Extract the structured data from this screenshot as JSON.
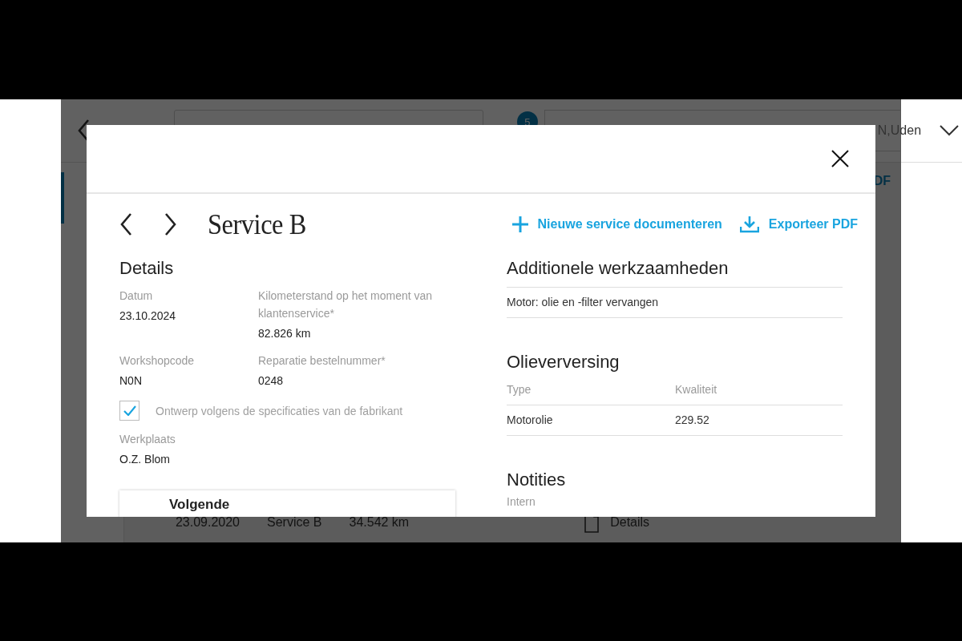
{
  "background": {
    "badge": "5",
    "location": "N,Uden",
    "export_link": "DF",
    "history_row": {
      "date": "23.09.2020",
      "service": "Service B",
      "mileage": "34.542 km",
      "details_link": "Details"
    }
  },
  "modal": {
    "title": "Service B",
    "actions": [
      {
        "kind": "add",
        "label": "Nieuwe service documenteren"
      },
      {
        "kind": "export",
        "label": "Exporteer PDF"
      }
    ],
    "details": {
      "heading": "Details",
      "fields": [
        {
          "label": "Datum",
          "value": "23.10.2024"
        },
        {
          "label": "Kilometerstand op het moment van klantenservice*",
          "value": "82.826 km"
        },
        {
          "label": "Workshopcode",
          "value": "N0N"
        },
        {
          "label": "Reparatie bestelnummer*",
          "value": "0248"
        }
      ],
      "checkbox": {
        "label": "Ontwerp volgens de specificaties van de fabrikant",
        "checked": true
      },
      "workshop": {
        "label": "Werkplaats",
        "value": "O.Z. Blom"
      },
      "next_card": {
        "title": "Volgende"
      }
    },
    "additional_work": {
      "heading": "Additionele werkzaamheden",
      "items": [
        "Motor: olie en -filter vervangen"
      ]
    },
    "oil_change": {
      "heading": "Olieverversing",
      "columns": [
        "Type",
        "Kwaliteit"
      ],
      "rows": [
        [
          "Motorolie",
          "229.52"
        ]
      ]
    },
    "notes": {
      "heading": "Notities",
      "label": "Intern"
    }
  }
}
